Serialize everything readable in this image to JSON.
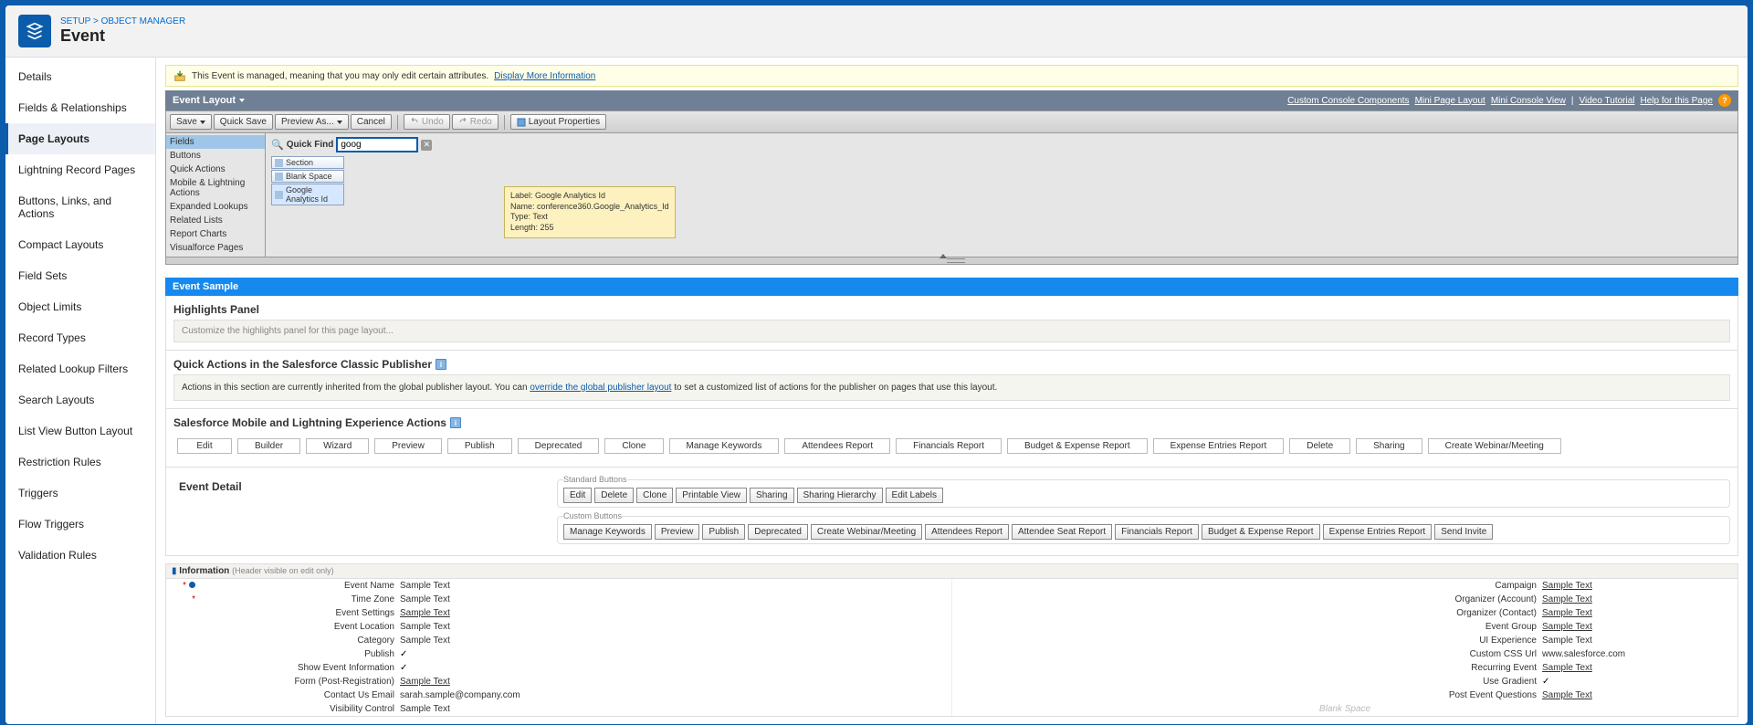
{
  "breadcrumb": {
    "setup": "SETUP",
    "sep": ">",
    "objectManager": "OBJECT MANAGER"
  },
  "pageTitle": "Event",
  "sidebar": {
    "items": [
      {
        "label": "Details"
      },
      {
        "label": "Fields & Relationships"
      },
      {
        "label": "Page Layouts",
        "selected": true
      },
      {
        "label": "Lightning Record Pages"
      },
      {
        "label": "Buttons, Links, and Actions"
      },
      {
        "label": "Compact Layouts"
      },
      {
        "label": "Field Sets"
      },
      {
        "label": "Object Limits"
      },
      {
        "label": "Record Types"
      },
      {
        "label": "Related Lookup Filters"
      },
      {
        "label": "Search Layouts"
      },
      {
        "label": "List View Button Layout"
      },
      {
        "label": "Restriction Rules"
      },
      {
        "label": "Triggers"
      },
      {
        "label": "Flow Triggers"
      },
      {
        "label": "Validation Rules"
      }
    ]
  },
  "managedBanner": {
    "text": "This Event is managed, meaning that you may only edit certain attributes.",
    "link": "Display More Information"
  },
  "layoutHeader": {
    "title": "Event Layout",
    "links": [
      "Custom Console Components",
      "Mini Page Layout",
      "Mini Console View",
      "|",
      "Video Tutorial",
      "Help for this Page"
    ]
  },
  "toolbar": {
    "save": "Save",
    "quickSave": "Quick Save",
    "previewAs": "Preview As...",
    "cancel": "Cancel",
    "undo": "Undo",
    "redo": "Redo",
    "layoutProps": "Layout Properties"
  },
  "palette": {
    "cats": [
      "Fields",
      "Buttons",
      "Quick Actions",
      "Mobile & Lightning Actions",
      "Expanded Lookups",
      "Related Lists",
      "Report Charts",
      "Visualforce Pages"
    ],
    "quickFindLabel": "Quick Find",
    "quickFindValue": "goog",
    "pills": [
      "Section",
      "Blank Space",
      "Google Analytics Id"
    ],
    "tooltip": {
      "l1": "Label: Google Analytics Id",
      "l2": "Name: conference360.Google_Analytics_Id",
      "l3": "Type: Text",
      "l4": "Length: 255"
    }
  },
  "sampleBar": "Event Sample",
  "highlights": {
    "title": "Highlights Panel",
    "body": "Customize the highlights panel for this page layout..."
  },
  "quickActions": {
    "title": "Quick Actions in the Salesforce Classic Publisher",
    "textBefore": "Actions in this section are currently inherited from the global publisher layout. You can ",
    "link": "override the global publisher layout",
    "textAfter": " to set a customized list of actions for the publisher on pages that use this layout."
  },
  "mobileActions": {
    "title": "Salesforce Mobile and Lightning Experience Actions",
    "chips": [
      "Edit",
      "Builder",
      "Wizard",
      "Preview",
      "Publish",
      "Deprecated",
      "Clone",
      "Manage Keywords",
      "Attendees Report",
      "Financials Report",
      "Budget & Expense Report",
      "Expense Entries Report",
      "Delete",
      "Sharing",
      "Create Webinar/Meeting"
    ]
  },
  "eventDetail": {
    "title": "Event Detail",
    "standardLegend": "Standard Buttons",
    "customLegend": "Custom Buttons",
    "standardButtons": [
      "Edit",
      "Delete",
      "Clone",
      "Printable View",
      "Sharing",
      "Sharing Hierarchy",
      "Edit Labels"
    ],
    "customButtons": [
      "Manage Keywords",
      "Preview",
      "Publish",
      "Deprecated",
      "Create Webinar/Meeting",
      "Attendees Report",
      "Attendee Seat Report",
      "Financials Report",
      "Budget & Expense Report",
      "Expense Entries Report",
      "Send Invite"
    ]
  },
  "infoSection": {
    "label": "Information",
    "hint": "(Header visible on edit only)"
  },
  "fieldsLeft": [
    {
      "label": "Event Name",
      "value": "Sample Text",
      "required": true,
      "dot": true
    },
    {
      "label": "Time Zone",
      "value": "Sample Text",
      "required": true
    },
    {
      "label": "Event Settings",
      "value": "Sample Text",
      "link": true
    },
    {
      "label": "Event Location",
      "value": "Sample Text"
    },
    {
      "label": "Category",
      "value": "Sample Text"
    },
    {
      "label": "Publish",
      "check": true
    },
    {
      "label": "Show Event Information",
      "check": true
    },
    {
      "label": "Form (Post-Registration)",
      "value": "Sample Text",
      "link": true
    },
    {
      "label": "Contact Us Email",
      "value": "sarah.sample@company.com"
    },
    {
      "label": "Visibility Control",
      "value": "Sample Text"
    }
  ],
  "fieldsRight": [
    {
      "label": "Campaign",
      "value": "Sample Text",
      "link": true
    },
    {
      "label": "Organizer (Account)",
      "value": "Sample Text",
      "link": true
    },
    {
      "label": "Organizer (Contact)",
      "value": "Sample Text",
      "link": true
    },
    {
      "label": "Event Group",
      "value": "Sample Text",
      "link": true
    },
    {
      "label": "UI Experience",
      "value": "Sample Text"
    },
    {
      "label": "Custom CSS Url",
      "value": "www.salesforce.com"
    },
    {
      "label": "Recurring Event",
      "value": "Sample Text",
      "link": true
    },
    {
      "label": "Use Gradient",
      "check": true
    },
    {
      "label": "Post Event Questions",
      "value": "Sample Text",
      "link": true
    }
  ],
  "blankSpace": "Blank Space"
}
